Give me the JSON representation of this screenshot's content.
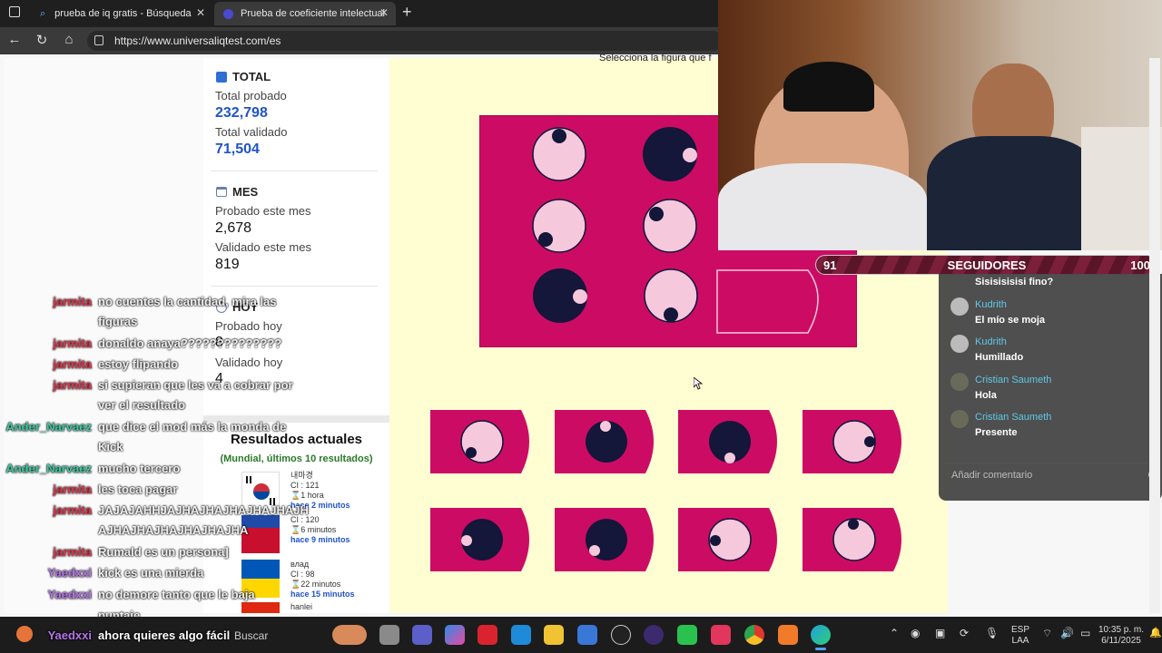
{
  "browser": {
    "tabs": [
      {
        "title": "prueba de iq gratis - Búsqueda",
        "close": "✕"
      },
      {
        "title": "Prueba de coeficiente intelectual",
        "close": "✕"
      }
    ],
    "new_tab": "+",
    "url": "https://www.universaliqtest.com/es"
  },
  "stats": {
    "total": {
      "heading": "TOTAL",
      "tested_label": "Total probado",
      "tested_value": "232,798",
      "validated_label": "Total validado",
      "validated_value": "71,504"
    },
    "month": {
      "heading": "MES",
      "tested_label": "Probado este mes",
      "tested_value": "2,678",
      "validated_label": "Validado este mes",
      "validated_value": "819"
    },
    "today": {
      "heading": "HOY",
      "tested_label": "Probado hoy",
      "tested_value": "8",
      "validated_label": "Validado hoy",
      "validated_value": "4"
    }
  },
  "results": {
    "title": "Resultados actuales",
    "subtitle": "(Mundial, últimos 10 resultados)",
    "items": [
      {
        "name": "내마경",
        "ci": "CI : 121",
        "dur": "⌛1 hora",
        "ago": "hace 2 minutos"
      },
      {
        "name": "",
        "ci": "CI : 120",
        "dur": "⌛6 minutos",
        "ago": "hace 9 minutos"
      },
      {
        "name": "влад",
        "ci": "CI : 98",
        "dur": "⌛22 minutos",
        "ago": "hace 15 minutos"
      },
      {
        "name": "hanlei",
        "ci": "",
        "dur": "",
        "ago": ""
      }
    ]
  },
  "puzzle": {
    "instruction": "Selecciona la figura que f"
  },
  "followers": {
    "left": "91",
    "label": "SEGUIDORES",
    "right": "100"
  },
  "comments": {
    "items": [
      {
        "user": "",
        "text": "Sisisisisisi fino?"
      },
      {
        "user": "Kudrith",
        "text": "El mío se moja"
      },
      {
        "user": "Kudrith",
        "text": "Humillado"
      },
      {
        "user": "Cristian Saumeth",
        "text": "Hola"
      },
      {
        "user": "Cristian Saumeth",
        "text": "Presente"
      }
    ],
    "input_placeholder": "Añadir comentario"
  },
  "chat": [
    {
      "user": "jarmita",
      "text": "no cuentes la cantidad, mira las",
      "color": "#e0344a"
    },
    {
      "user": "",
      "text": "figuras",
      "color": "#e0344a"
    },
    {
      "user": "jarmita",
      "text": "donaldo anaya??????????????",
      "color": "#e0344a"
    },
    {
      "user": "jarmita",
      "text": "estoy flipando",
      "color": "#e0344a"
    },
    {
      "user": "jarmita",
      "text": "si supieran que les va a cobrar por",
      "color": "#e0344a"
    },
    {
      "user": "",
      "text": "ver el resultado",
      "color": "#e0344a"
    },
    {
      "user": "Ander_Narvaez",
      "text": "que dice el mod más la monda de",
      "color": "#3cc9a0"
    },
    {
      "user": "",
      "text": "Kick",
      "color": "#3cc9a0"
    },
    {
      "user": "Ander_Narvaez",
      "text": "mucho tercero",
      "color": "#3cc9a0"
    },
    {
      "user": "jarmita",
      "text": "les toca pagar",
      "color": "#e0344a"
    },
    {
      "user": "jarmita",
      "text": "JAJAJAHHJAJHAJHAJHAJHAJHAJH",
      "color": "#e0344a"
    },
    {
      "user": "",
      "text": "AJHAJHAJHAJHAJHAJHA",
      "color": "#e0344a"
    },
    {
      "user": "jarmita",
      "text": "Rumald es un persona]",
      "color": "#e0344a"
    },
    {
      "user": "Yaedxxi",
      "text": "kick es una mierda",
      "color": "#b574e8"
    },
    {
      "user": "Yaedxxi",
      "text": "no demore tanto que le baja",
      "color": "#b574e8"
    },
    {
      "user": "",
      "text": "puntaje",
      "color": "#b574e8"
    },
    {
      "user": "Yaedxxi",
      "text": "ahora quieres algo fácil",
      "color": "#b574e8"
    }
  ],
  "taskbar": {
    "search_placeholder": "Buscar",
    "lang_top": "ESP",
    "lang_bottom": "LAA",
    "time": "10:35 p. m.",
    "date": "6/11/2025"
  }
}
